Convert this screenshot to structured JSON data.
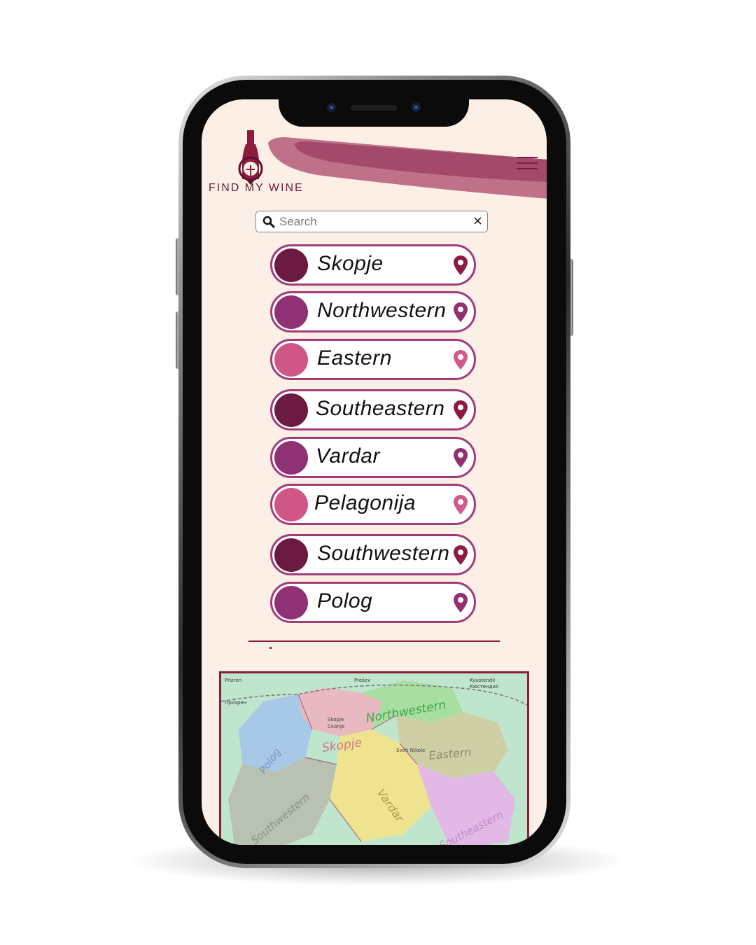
{
  "app": {
    "logo_text": "FIND MY WINE"
  },
  "search": {
    "placeholder": "Search",
    "value": "",
    "clear_label": "×"
  },
  "regions": [
    {
      "label": "Skopje",
      "color": "#6b1a42"
    },
    {
      "label": "Northwestern",
      "color": "#8f3174"
    },
    {
      "label": "Eastern",
      "color": "#cf5687"
    },
    {
      "label": "Southeastern",
      "color": "#6b1a42"
    },
    {
      "label": "Vardar",
      "color": "#8f3174"
    },
    {
      "label": "Pelagonija",
      "color": "#cf5687"
    },
    {
      "label": "Southwestern",
      "color": "#6b1a42"
    },
    {
      "label": "Polog",
      "color": "#8f3174"
    }
  ],
  "map": {
    "region_labels": [
      "Northwestern",
      "Skopje",
      "Eastern",
      "Polog",
      "Vardar",
      "Southwestern",
      "Southeastern"
    ],
    "place_labels": [
      "Prizren",
      "Призрен",
      "Skopje",
      "Скопје",
      "Kyustendil",
      "Кюстендил",
      "Prešev",
      "Sveti Nikole"
    ]
  },
  "theme": {
    "accent": "#8c1c3e",
    "border": "#a23b7c",
    "background": "#fcefe6"
  }
}
